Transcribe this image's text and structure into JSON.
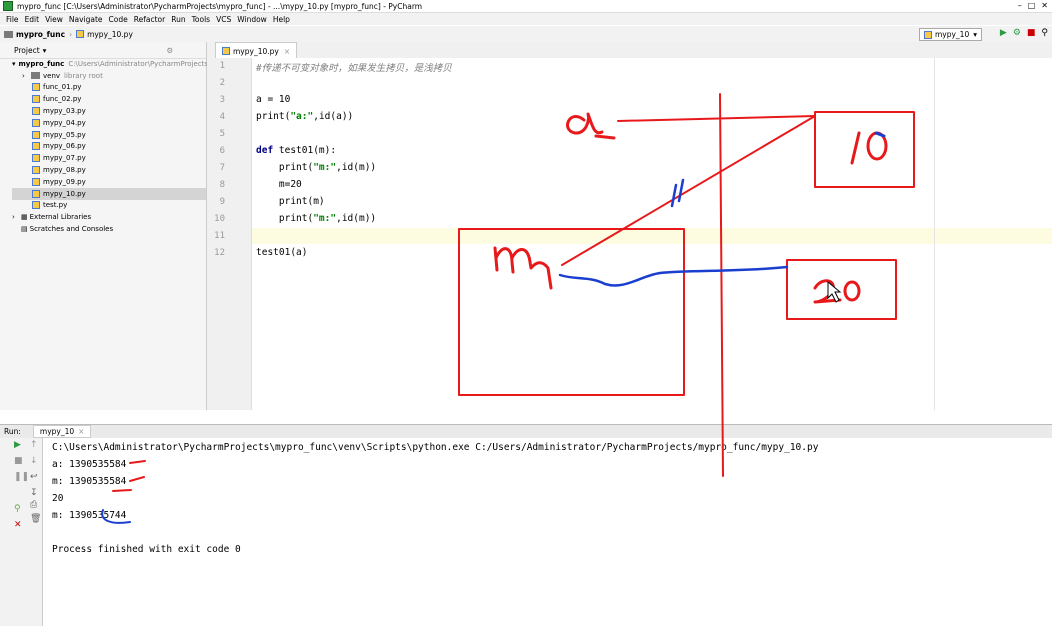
{
  "window": {
    "title": "mypro_func [C:\\Users\\Administrator\\PycharmProjects\\mypro_func] - ...\\mypy_10.py [mypro_func] - PyCharm"
  },
  "menu": [
    "File",
    "Edit",
    "View",
    "Navigate",
    "Code",
    "Refactor",
    "Run",
    "Tools",
    "VCS",
    "Window",
    "Help"
  ],
  "breadcrumb": {
    "project": "mypro_func",
    "file": "mypy_10.py"
  },
  "run_config": "mypy_10",
  "sidebar": {
    "tab": "Project",
    "root_name": "mypro_func",
    "root_path": "C:\\Users\\Administrator\\PycharmProjects",
    "venv": "venv",
    "venv_note": "library root",
    "files": [
      "func_01.py",
      "func_02.py",
      "mypy_03.py",
      "mypy_04.py",
      "mypy_05.py",
      "mypy_06.py",
      "mypy_07.py",
      "mypy_08.py",
      "mypy_09.py",
      "mypy_10.py",
      "test.py"
    ],
    "external": "External Libraries",
    "scratches": "Scratches and Consoles"
  },
  "editor": {
    "tab": "mypy_10.py",
    "line_numbers": [
      "1",
      "2",
      "3",
      "4",
      "5",
      "6",
      "7",
      "8",
      "9",
      "10",
      "11",
      "12"
    ],
    "code": {
      "l1": "#传递不可变对象时，如果发生拷贝，是浅拷贝",
      "l3": "a = 10",
      "l4a": "print(",
      "l4s": "\"a:\"",
      "l4b": ",id(a))",
      "l6kw": "def",
      "l6": " test01(m):",
      "l7a": "    print(",
      "l7s": "\"m:\"",
      "l7b": ",id(m))",
      "l8": "    m=20",
      "l9": "    print(m)",
      "l10a": "    print(",
      "l10s": "\"m:\"",
      "l10b": ",id(m))",
      "l12": "test01(a)"
    }
  },
  "run": {
    "label": "Run:",
    "tab": "mypy_10",
    "output": [
      "C:\\Users\\Administrator\\PycharmProjects\\mypro_func\\venv\\Scripts\\python.exe C:/Users/Administrator/PycharmProjects/mypro_func/mypy_10.py",
      "a: 1390535584",
      "m: 1390535584",
      "20",
      "m: 1390535744",
      "",
      "Process finished with exit code 0"
    ]
  },
  "annotations": {
    "box_top_text": "10",
    "box_bottom_text": "20",
    "left_letter": "a",
    "mid_letter": "m",
    "colors": {
      "red": "#e8191a",
      "blue": "#1a3fd0"
    }
  }
}
